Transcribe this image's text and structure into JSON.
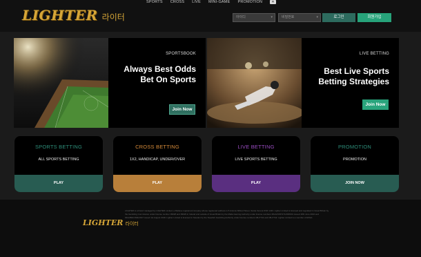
{
  "nav": {
    "items": [
      "SPORTS",
      "CROSS",
      "LIVE",
      "MINI-GAME",
      "PROMOTION"
    ],
    "close": "✕"
  },
  "logo": {
    "text": "LIGHTER",
    "korean": "라이터"
  },
  "login": {
    "id_placeholder": "아이디",
    "pw_placeholder": "비밀번호",
    "login_button": "로그인",
    "join_button": "회원가입"
  },
  "banners": [
    {
      "tag": "SPORTSBOOK",
      "heading": "Always Best Odds Bet On Sports",
      "button": "Join Now"
    },
    {
      "tag": "LIVE BETTING",
      "heading": "Best Live Sports Betting Strategies",
      "button": "Join Now"
    }
  ],
  "cards": [
    {
      "title": "SPORTS BETTING",
      "subtitle": "ALL SPORTS BETTING",
      "button": "PLAY",
      "color": "#2e8e7a"
    },
    {
      "title": "CROSS BETTING",
      "subtitle": "1X2, HANDICAP, UNDER/OVER",
      "button": "PLAY",
      "color": "#d68b3a"
    },
    {
      "title": "LIVE BETTING",
      "subtitle": "LIVE SPORTS BETTING",
      "button": "PLAY",
      "color": "#9b4dc3"
    },
    {
      "title": "PROMOTION",
      "subtitle": "PROMOTION",
      "button": "JOIN NOW",
      "color": "#2e8e7a"
    }
  ],
  "footer": {
    "logo_text": "LIGHTER",
    "logo_korean": "라이터",
    "legal": "LIGHTER is a brand managed by LIGHTER Limited, a Maltese registered company whose registered address is 5 Antonio Mifsud Street, Santa Venera SVR 1433. Lighter Limited is licensed and regulated in Great Britain by the Gambling Commission under license number 39028 and 39029 in Ireland and outside of Great Britain by the Malta Gaming Authority under license numbers MGA/CRP/171/2009/01 issued 18th June 2010 and MGA/B2C/394/2017 issued 1st August 2018. Lighter Limited is licensed in Sweden by the Swedish Gambling Authority under license numbers 18Li7741 and 18Li7742. Lighter Limited is a member of ESSA."
  },
  "colors": {
    "accent_teal": "#27a37a",
    "gold": "#d6a637"
  }
}
